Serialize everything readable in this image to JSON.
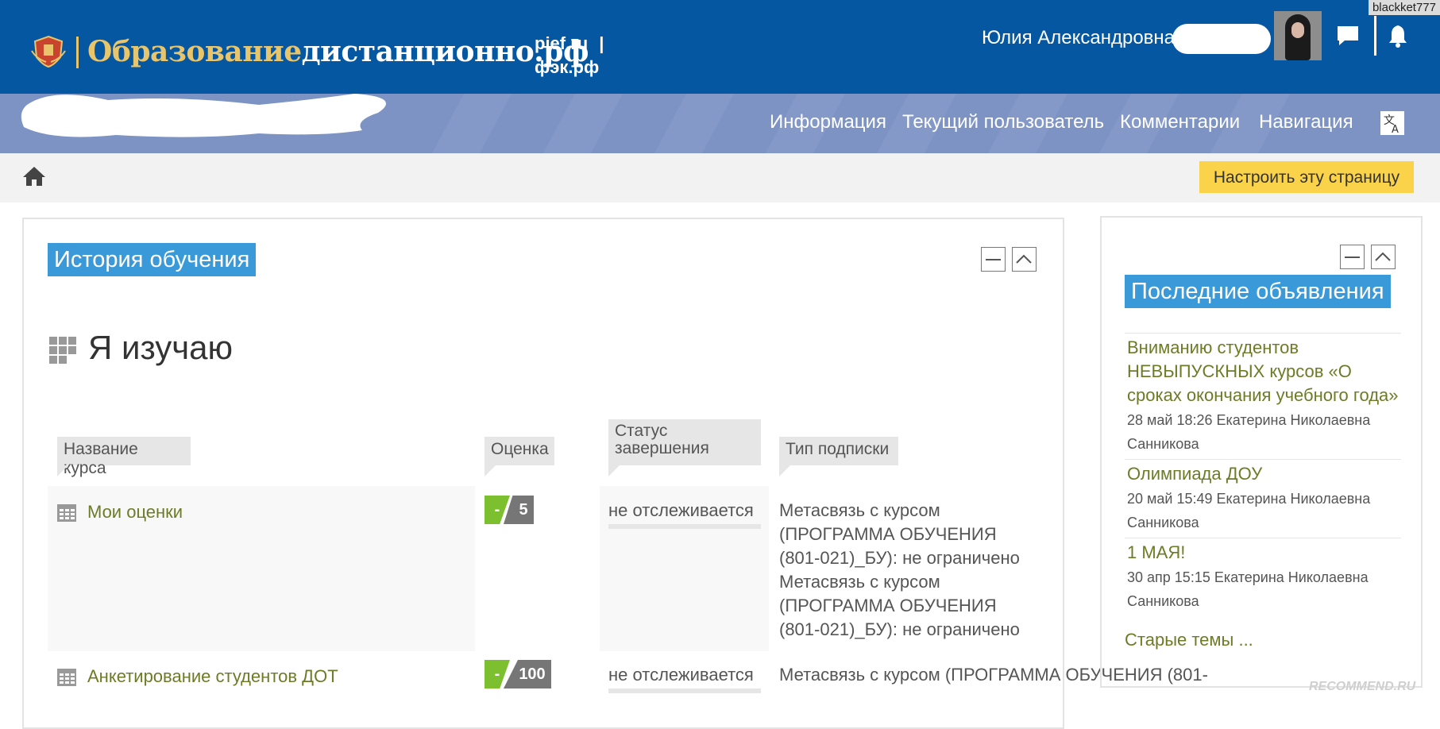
{
  "header": {
    "logo_part1": "Образование",
    "logo_part2": "дистанционно.рф",
    "link_1": "pief.ru",
    "link_separator": "|",
    "link_2": "фэк.рф",
    "user_name": "Юлия Александровна",
    "corner_label": "blackket777",
    "icons": [
      "messages-icon",
      "notifications-icon",
      "avatar"
    ]
  },
  "nav": {
    "items": [
      "Информация",
      "Текущий пользователь",
      "Комментарии",
      "Навигация"
    ],
    "language_icon": "translate-icon"
  },
  "breadcrumb": {
    "home_icon": "home-icon",
    "customize_button": "Настроить эту страницу"
  },
  "main_block": {
    "title": "История обучения",
    "section_title": "Я изучаю",
    "columns": [
      "Название курса",
      "Оценка",
      "Статус\nзавершения",
      "Тип подписки"
    ],
    "rows": [
      {
        "course": "Мои оценки",
        "grade_dash": "-",
        "grade_value": "5",
        "status": "не отслеживается",
        "subscription": "Метасвязь с курсом (ПРОГРАММА ОБУЧЕНИЯ (801-021)_БУ): не ограничено Метасвязь с курсом (ПРОГРАММА ОБУЧЕНИЯ (801-021)_БУ): не ограничено"
      },
      {
        "course": "Анкетирование студентов ДОТ",
        "grade_dash": "-",
        "grade_value": "100",
        "status": "не отслеживается",
        "subscription": "Метасвязь с курсом (ПРОГРАММА ОБУЧЕНИЯ (801-"
      }
    ]
  },
  "side_block": {
    "title": "Последние объявления",
    "news": [
      {
        "title": "Вниманию студентов НЕВЫПУСКНЫХ курсов «О сроках окончания учебного года»",
        "meta": "28 май 18:26  Екатерина Николаевна Санникова"
      },
      {
        "title": "Олимпиада ДОУ",
        "meta": "20 май 15:49  Екатерина Николаевна Санникова"
      },
      {
        "title": "1 МАЯ!",
        "meta": "30 апр 15:15  Екатерина Николаевна Санникова"
      }
    ],
    "old_topics": "Старые темы ..."
  },
  "watermark": "RECOMMEND.RU",
  "colors": {
    "header_blue": "#0657a1",
    "nav_blue": "#7d93c4",
    "title_blue": "#3a9ad9",
    "customize_yellow": "#fbd34a",
    "link_olive": "#6e7b26",
    "grade_green": "#7cbf2f"
  }
}
